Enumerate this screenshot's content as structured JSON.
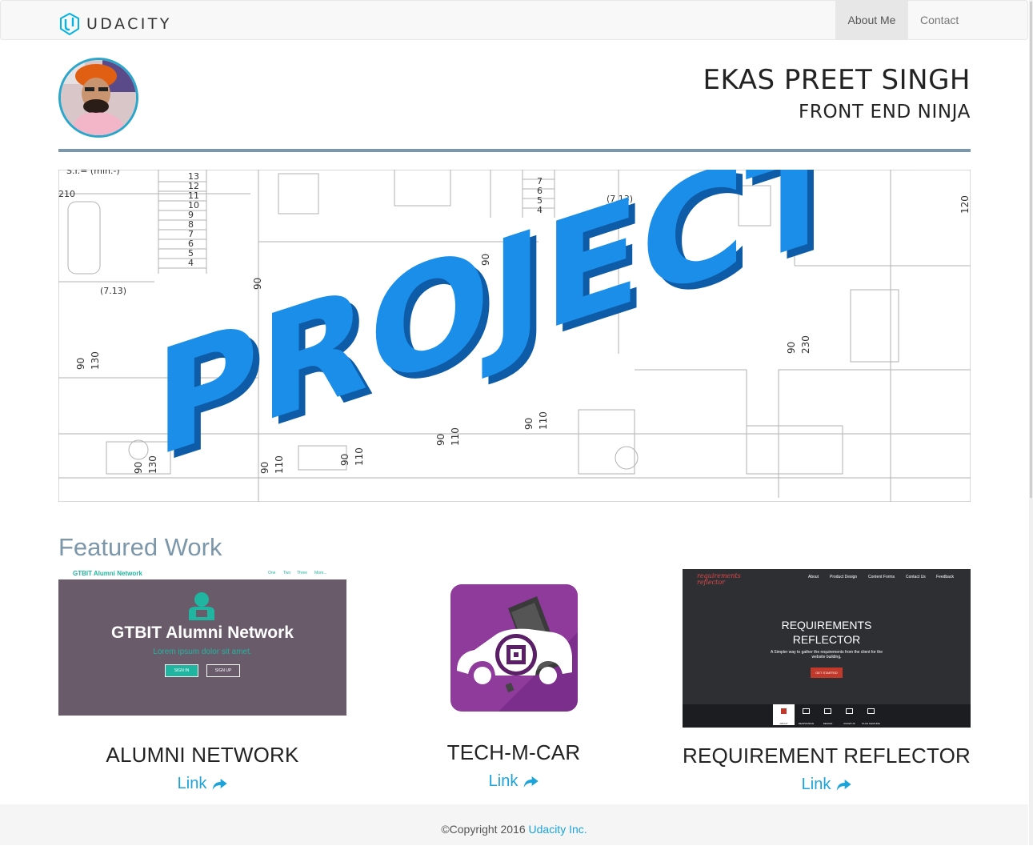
{
  "navbar": {
    "brand": "UDACITY",
    "links": [
      {
        "label": "About Me",
        "active": true
      },
      {
        "label": "Contact",
        "active": false
      }
    ]
  },
  "header": {
    "name": "EKAS PREET SINGH",
    "job_title": "FRONT END NINJA"
  },
  "hero": {
    "word": "PROJECT",
    "blueprint_numbers": [
      "13",
      "12",
      "11",
      "10",
      "9",
      "8",
      "7",
      "6",
      "5",
      "4",
      "210",
      "(7.13)",
      "90",
      "130",
      "(7.13)",
      "120",
      "230",
      "90",
      "110",
      "90",
      "130",
      "110",
      "90",
      "90",
      "110",
      "6",
      "5",
      "4"
    ]
  },
  "featured": {
    "title": "Featured Work",
    "projects": [
      {
        "title": "ALUMNI NETWORK",
        "link_label": "Link",
        "thumb": {
          "brand": "GTBIT Alumni Network",
          "nav": [
            "One",
            "Two",
            "Three",
            "More..."
          ],
          "heading": "GTBIT Alumni Network",
          "tagline": "Lorem ipsum dolor sit amet.",
          "btn_signin": "SIGN IN",
          "btn_signup": "SIGN UP"
        }
      },
      {
        "title": "TECH-M-CAR",
        "link_label": "Link"
      },
      {
        "title": "REQUIREMENT REFLECTOR",
        "link_label": "Link",
        "thumb": {
          "logo": "requirements reflector",
          "nav": [
            "About",
            "Product Design",
            "Content Forms",
            "Contact Us",
            "Feedback"
          ],
          "heading1": "REQUIREMENTS",
          "heading2": "REFLECTOR",
          "tagline1": "A Simpler way to gather the requirements from the client for the",
          "tagline2": "website building.",
          "cta": "GET STARTED",
          "tabs": [
            "ABOUT",
            "RESPONSIVE",
            "DESIGN",
            "KNOW US",
            "PLUS FEATURE"
          ]
        }
      }
    ]
  },
  "footer": {
    "copyright": "©Copyright 2016",
    "company": "Udacity Inc."
  },
  "colors": {
    "accent": "#1ba3da",
    "rule": "#7d97aa",
    "hero_blue": "#1a8ee8",
    "alumni_bg": "#6a5b6b",
    "alumni_teal": "#1fb5a0",
    "reflector_bg": "#2d2f33",
    "reflector_red": "#c0392b",
    "car_purple": "#8e3b9b"
  }
}
